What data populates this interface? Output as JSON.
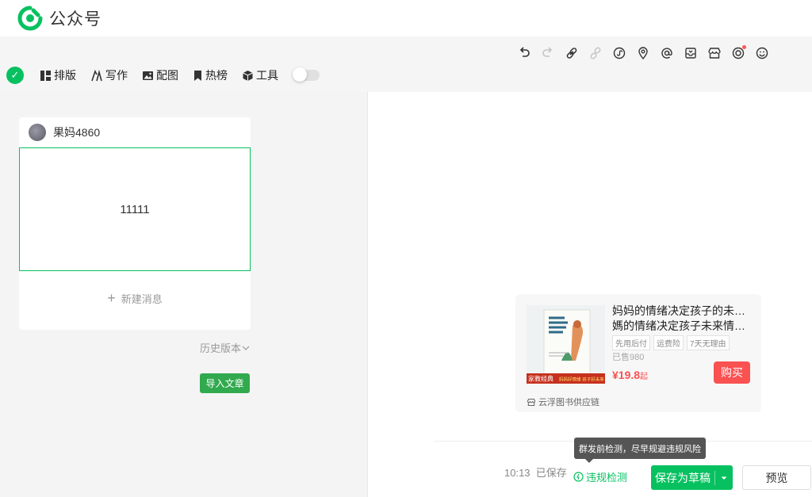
{
  "app": {
    "brand": "公众号"
  },
  "toolbar_left": {
    "items": [
      {
        "label": "排版",
        "icon": "layout-icon"
      },
      {
        "label": "写作",
        "icon": "write-icon"
      },
      {
        "label": "配图",
        "icon": "image-icon"
      },
      {
        "label": "热榜",
        "icon": "bookmark-icon"
      },
      {
        "label": "工具",
        "icon": "cube-icon"
      }
    ],
    "toggle_on": false
  },
  "toolbar_right": {
    "icons": [
      "undo-icon",
      "redo-icon",
      "link-icon",
      "unlink-icon",
      "mini-program-icon",
      "location-icon",
      "mention-icon",
      "inbox-icon",
      "shop-icon",
      "target-icon",
      "emoji-icon"
    ]
  },
  "article_list": {
    "account_name": "果妈4860",
    "article_title": "11111",
    "new_message": "新建消息",
    "history": "历史版本",
    "import": "导入文章"
  },
  "product": {
    "title_line1": "妈妈的情绪决定孩子的未来媽",
    "title_line2": "媽的情绪决定孩子未来情绪…",
    "tags": [
      "先用后付",
      "运费险",
      "7天无理由"
    ],
    "sold": "已售980",
    "price": "¥19.8",
    "price_suffix": "起",
    "buy": "购买",
    "supplier": "云浮图书供应链",
    "cover_badge": "家教经典",
    "cover_subtitle": "妈妈好情绪 孩子好未来"
  },
  "footer": {
    "tooltip": "群发前检测，尽早规避违规风险",
    "save_time": "10:13",
    "save_status": "已保存",
    "check": "违规检测",
    "save_draft": "保存为草稿",
    "preview": "预览"
  },
  "colors": {
    "accent": "#07c160",
    "buy": "#fa5151",
    "import": "#31a94f"
  }
}
